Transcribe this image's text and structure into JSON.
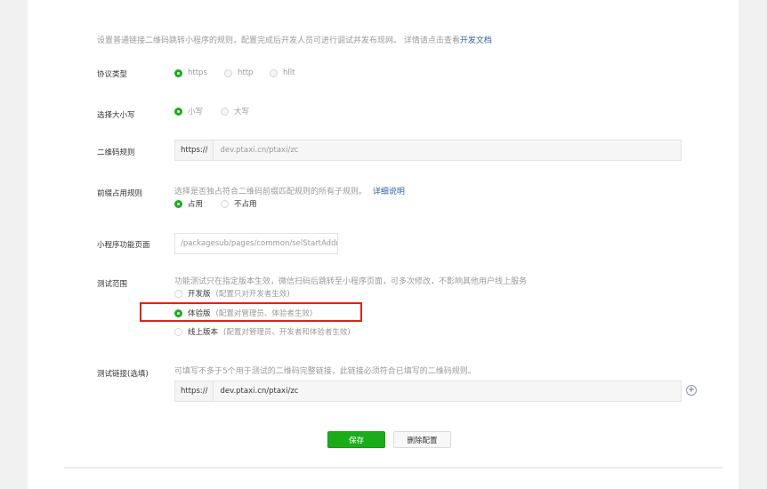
{
  "intro": {
    "text": "设置普通链接二维码跳转小程序的规则，配置完成后开发人员可进行调试并发布现网。 详情请点击查看",
    "link": "开发文档"
  },
  "protocol": {
    "label": "协议类型",
    "options": [
      "https",
      "http",
      "hllt"
    ],
    "selected": 0
  },
  "case": {
    "label": "选择大小写",
    "options": [
      "小写",
      "大写"
    ],
    "selected": 0
  },
  "qr_rule": {
    "label": "二维码规则",
    "prefix": "https://",
    "value": "dev.ptaxi.cn/ptaxi/zc"
  },
  "prefix_rule": {
    "label": "前缀占用规则",
    "desc": "选择是否独占符合二维码前缀匹配规则的所有子规则。",
    "link": "详细说明",
    "options": [
      "占用",
      "不占用"
    ],
    "selected": 0
  },
  "page": {
    "label": "小程序功能页面",
    "value": "/packagesub/pages/common/selStartAddr"
  },
  "test_scope": {
    "label": "测试范围",
    "desc": "功能测试只在指定版本生效，微信扫码后跳转至小程序页面，可多次修改，不影响其他用户线上服务",
    "options": [
      {
        "name": "开发版",
        "note": "(配置只对开发者生效)"
      },
      {
        "name": "体验版",
        "note": "(配置对管理员、体验者生效)"
      },
      {
        "name": "线上版本",
        "note": "(配置对管理员、开发者和体验者生效)"
      }
    ],
    "selected": 1
  },
  "test_link": {
    "label": "测试链接(选填)",
    "desc": "可填写不多于5个用于测试的二维码完整链接，此链接必须符合已填写的二维码规则。",
    "prefix": "https://",
    "value": "dev.ptaxi.cn/ptaxi/zc",
    "add_icon": "plus-circle-icon"
  },
  "actions": {
    "save": "保存",
    "delete": "删除配置"
  },
  "colors": {
    "primary": "#1aad19",
    "highlight": "#e42019",
    "link": "#2f5fb0"
  }
}
